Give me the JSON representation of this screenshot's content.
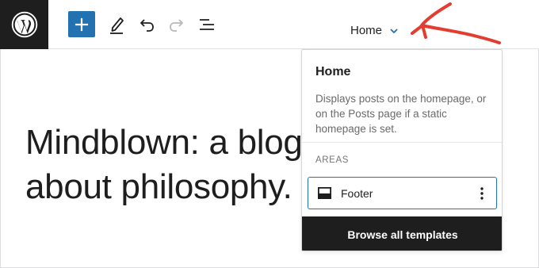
{
  "toolbar": {
    "logo_icon": "wordpress-logo-icon",
    "add_icon": "plus-icon",
    "tools_icon": "pencil-icon",
    "undo_icon": "undo-icon",
    "redo_icon": "redo-icon",
    "list_view_icon": "list-view-icon",
    "document_title": "Home",
    "document_chevron_icon": "chevron-down-icon",
    "accent_color": "#2271b1"
  },
  "annotation": {
    "arrow_color": "#e43d2f"
  },
  "canvas": {
    "heading": "Mindblown: a blog about philosophy."
  },
  "template_popover": {
    "title": "Home",
    "description": "Displays posts on the homepage, or on the Posts page if a static homepage is set.",
    "areas_label": "AREAS",
    "areas": [
      {
        "label": "Footer",
        "icon": "footer-layout-icon",
        "more_icon": "more-vertical-icon"
      }
    ],
    "browse_button": "Browse all templates"
  }
}
